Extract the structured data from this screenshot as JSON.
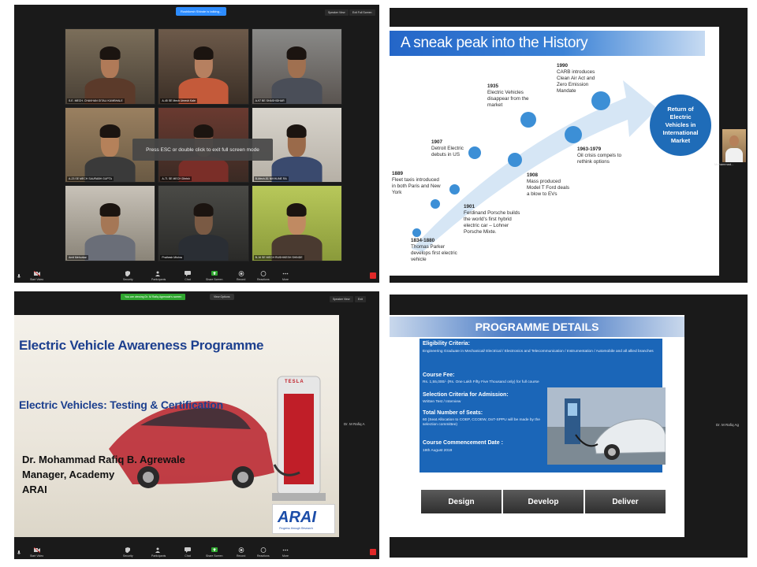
{
  "meeting1": {
    "talking_banner": "Rushikesh Shinde is talking...",
    "speaker_view": "Speaker View",
    "exit_fullscreen": "Exit Full Screen",
    "esc_message": "Press ESC or double click to exit full screen mode",
    "participants": [
      {
        "name": "S.E. MECH. CHAVHAN GITALI KUMBHALE"
      },
      {
        "name": "A-45 SE Mech Umesh Kale"
      },
      {
        "name": "A-97 BE SHASHIDHAR"
      },
      {
        "name": "A-23 SE MECH SAURABH GUPTA"
      },
      {
        "name": "A-71 SE MECH Dhrish"
      },
      {
        "name": "B-Mech-51 NIKHLINE RA"
      },
      {
        "name": "Amit Mehurkar"
      },
      {
        "name": "Prathesh Mishra"
      },
      {
        "name": "B-16 SE MECH RUSHIKESH SHINDE"
      }
    ],
    "participant_count": "61"
  },
  "toolbar": {
    "start_video": "Start Video",
    "security": "Security",
    "participants": "Participants",
    "chat": "Chat",
    "share_screen": "Share Screen",
    "record": "Record",
    "reactions": "Reactions",
    "more": "More"
  },
  "history_slide": {
    "title": "A sneak peak into the History",
    "events": [
      {
        "year": "1834-1880",
        "text": "Thomas Parker develops first electric vehicle"
      },
      {
        "year": "1889",
        "text": "Fleet taxis introduced in both Paris and New York"
      },
      {
        "year": "1901",
        "text": "Ferdinand Porsche builds the world's first hybrid electric car – Lohner Porsche Mixte."
      },
      {
        "year": "1907",
        "text": "Detroit Electric debuts in US"
      },
      {
        "year": "1908",
        "text": "Mass produced Model T Ford deals a blow to EVs"
      },
      {
        "year": "1935",
        "text": "Electric Vehicles disappear from the market"
      },
      {
        "year": "1963-1979",
        "text": "Oil crisis compels to rethink options"
      },
      {
        "year": "1990",
        "text": "CARB introduces Clean Air Act and Zero Emission Mandate"
      }
    ],
    "return_text": "Return of Electric Vehicles in International Market",
    "presenter_name": "Mohammad..."
  },
  "meeting3": {
    "sharing_banner": "You are viewing Dr. M Rafiq Agrewale's screen",
    "view_options": "View Options",
    "speaker_view": "Speaker View",
    "exit": "Exit",
    "side_name": "Dr. M Rafiq A",
    "participant_count": "61"
  },
  "intro_slide": {
    "title": "Electric Vehicle Awareness Programme",
    "subtitle": "Electric Vehicles: Testing & Certification",
    "speaker_name": "Dr. Mohammad Rafiq B. Agrewale",
    "speaker_role": "Manager, Academy",
    "speaker_org": "ARAI",
    "brand": "TESLA",
    "logo_text": "ARAI",
    "logo_tagline": "Progress through Research"
  },
  "programme_slide": {
    "title": "PROGRAMME DETAILS",
    "sections": [
      {
        "heading": "Eligibility Criteria:",
        "text": "Engineering Graduate in Mechanical/ Electrical / Electronics and Telecommunication / Instrumentation / Automobile and all allied branches"
      },
      {
        "heading": "Course Fee:",
        "text": "Rs. 1,55,000/- (Rs. One Lakh Fifty Five Thousand only) for full course"
      },
      {
        "heading": "Selection Criteria for Admission:",
        "text": "Written Test / Interview"
      },
      {
        "heading": "Total Number of Seats:",
        "text": "60 (Seat Allocation to COEP, CCOEW, DoT-SPPU will be made by the selection committee)"
      },
      {
        "heading": "Course Commencement Date :",
        "text": "19th August 2019"
      }
    ],
    "tabs": [
      "Design",
      "Develop",
      "Deliver"
    ],
    "side_name": "Dr. M Rafiq Ag"
  },
  "colors": {
    "zoom_blue": "#2d8cff",
    "slide_blue": "#1b66b8",
    "title_blue": "#1c3f8e",
    "end_red": "#e02828"
  }
}
